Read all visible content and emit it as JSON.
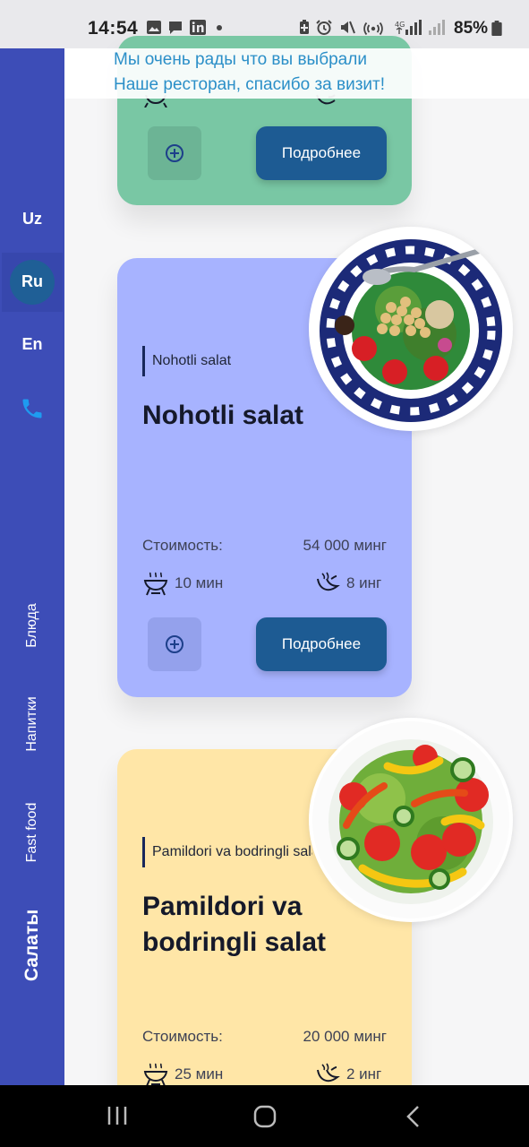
{
  "status_bar": {
    "time": "14:54",
    "battery": "85%"
  },
  "greeting": {
    "line1": "Мы очень рады что  вы выбрали",
    "line2": "Наше ресторан, спасибо за визит!"
  },
  "languages": [
    "Uz",
    "Ru",
    "En"
  ],
  "active_language": "Ru",
  "categories": [
    "Блюда",
    "Напитки",
    "Fast food",
    "Салаты"
  ],
  "active_category": "Салаты",
  "cards": [
    {
      "more_label": "Подробнее",
      "color": "#79c7a4"
    },
    {
      "tag": "Nohotli salat",
      "title": "Nohotli salat",
      "price_label": "Стоимость:",
      "price": "54 000 минг",
      "time": "10 мин",
      "ingredients": "8 инг",
      "more_label": "Подробнее",
      "color": "#a7b3ff"
    },
    {
      "tag": "Pamildori va bodringli salat",
      "title": "Pamildori va bodringli salat",
      "price_label": "Стоимость:",
      "price": "20 000 минг",
      "time": "25 мин",
      "ingredients": "2 инг",
      "color": "#ffe6a7"
    }
  ],
  "colors": {
    "sidebar": "#3d4db7",
    "button": "#1d5b93",
    "greeting_text": "#2b8fc8",
    "phone_icon": "#1e9bf0"
  }
}
